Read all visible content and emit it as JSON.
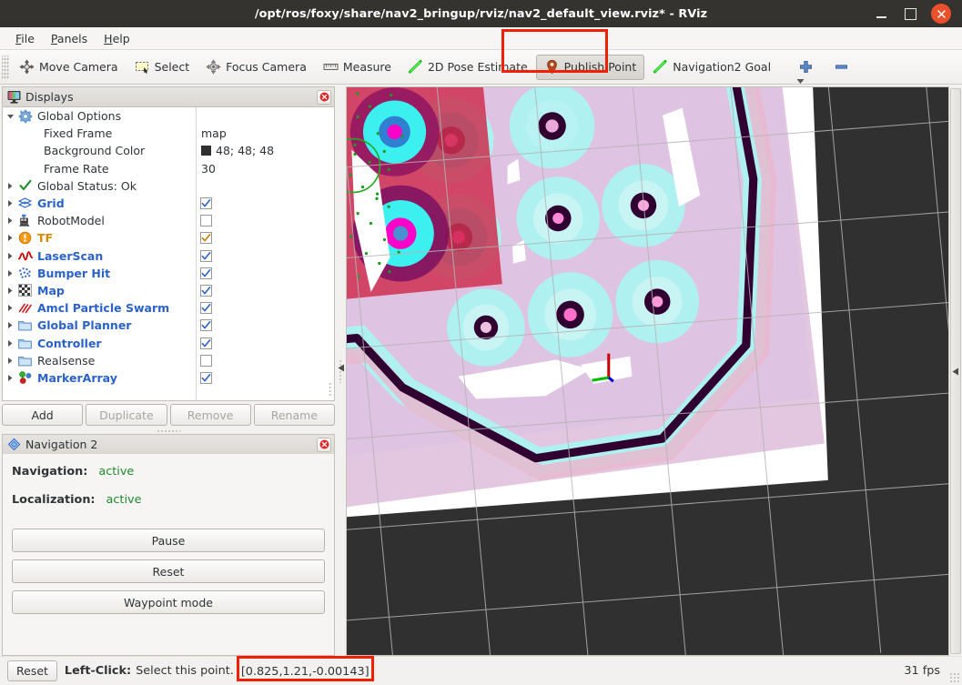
{
  "window": {
    "title": "/opt/ros/foxy/share/nav2_bringup/rviz/nav2_default_view.rviz* - RViz",
    "minimize_label": "minimize-window",
    "maximize_label": "maximize-window",
    "close_label": "close-window"
  },
  "menubar": {
    "items": [
      {
        "label": "File"
      },
      {
        "label": "Panels"
      },
      {
        "label": "Help"
      }
    ]
  },
  "toolbar": {
    "items": [
      {
        "label": "Move Camera",
        "icon": "move-camera-icon",
        "checked": false
      },
      {
        "label": "Select",
        "icon": "select-icon",
        "checked": false
      },
      {
        "label": "Focus Camera",
        "icon": "focus-camera-icon",
        "checked": false
      },
      {
        "label": "Measure",
        "icon": "measure-icon",
        "checked": false
      },
      {
        "label": "2D Pose Estimate",
        "icon": "pose-estimate-icon",
        "checked": false
      },
      {
        "label": "Publish Point",
        "icon": "publish-point-icon",
        "checked": true
      },
      {
        "label": "Navigation2 Goal",
        "icon": "navigation-goal-icon",
        "checked": false
      }
    ],
    "add_tool_icon": "plus-icon",
    "remove_tool_icon": "minus-icon",
    "overflow_icon": "chevron-down-icon",
    "highlight_color": "#f02000"
  },
  "displays_panel": {
    "title": "Displays",
    "icon": "display-monitor-icon",
    "close_icon": "close-icon",
    "rows": [
      {
        "label": "Global Options",
        "icon": "gear-icon",
        "arrow": "down",
        "style": "plain",
        "control": "none"
      },
      {
        "label": "Fixed Frame",
        "icon": "none",
        "arrow": "none",
        "style": "plain",
        "control": "text",
        "value": "map",
        "indent": 2
      },
      {
        "label": "Background Color",
        "icon": "none",
        "arrow": "none",
        "style": "plain",
        "control": "color",
        "value": "48; 48; 48",
        "swatch": "#303030",
        "indent": 2
      },
      {
        "label": "Frame Rate",
        "icon": "none",
        "arrow": "none",
        "style": "plain",
        "control": "text",
        "value": "30",
        "indent": 2
      },
      {
        "label": "Global Status: Ok",
        "icon": "check-icon",
        "arrow": "right",
        "style": "plain",
        "control": "none"
      },
      {
        "label": "Grid",
        "icon": "grid-icon",
        "arrow": "right",
        "style": "blue",
        "control": "checkbox",
        "checked": true
      },
      {
        "label": "RobotModel",
        "icon": "robot-icon",
        "arrow": "right",
        "style": "plain",
        "control": "checkbox",
        "checked": false
      },
      {
        "label": "TF",
        "icon": "tf-icon",
        "arrow": "right",
        "style": "orange",
        "control": "checkbox",
        "checked": true,
        "check_color": "#c08000"
      },
      {
        "label": "LaserScan",
        "icon": "laserscan-icon",
        "arrow": "right",
        "style": "blue",
        "control": "checkbox",
        "checked": true
      },
      {
        "label": "Bumper Hit",
        "icon": "pointcloud-icon",
        "arrow": "right",
        "style": "blue",
        "control": "checkbox",
        "checked": true
      },
      {
        "label": "Map",
        "icon": "map-icon",
        "arrow": "right",
        "style": "blue",
        "control": "checkbox",
        "checked": true
      },
      {
        "label": "Amcl Particle Swarm",
        "icon": "posearray-icon",
        "arrow": "right",
        "style": "blue",
        "control": "checkbox",
        "checked": true
      },
      {
        "label": "Global Planner",
        "icon": "folder-icon",
        "arrow": "right",
        "style": "blue",
        "control": "checkbox",
        "checked": true
      },
      {
        "label": "Controller",
        "icon": "folder-icon",
        "arrow": "right",
        "style": "blue",
        "control": "checkbox",
        "checked": true
      },
      {
        "label": "Realsense",
        "icon": "folder-icon",
        "arrow": "right",
        "style": "plain",
        "control": "checkbox",
        "checked": false
      },
      {
        "label": "MarkerArray",
        "icon": "markerarray-icon",
        "arrow": "right",
        "style": "blue",
        "control": "checkbox",
        "checked": true
      }
    ],
    "buttons": [
      {
        "label": "Add",
        "enabled": true
      },
      {
        "label": "Duplicate",
        "enabled": false
      },
      {
        "label": "Remove",
        "enabled": false
      },
      {
        "label": "Rename",
        "enabled": false
      }
    ]
  },
  "nav_panel": {
    "title": "Navigation 2",
    "icon": "nav2-diamond-icon",
    "close_icon": "close-icon",
    "status": [
      {
        "key": "Navigation:",
        "value": "active"
      },
      {
        "key": "Localization:",
        "value": "active"
      }
    ],
    "buttons": [
      {
        "label": "Pause"
      },
      {
        "label": "Reset"
      },
      {
        "label": "Waypoint mode"
      }
    ],
    "status_color": "#1f8a2a"
  },
  "statusbar": {
    "reset_label": "Reset",
    "hint_prefix": "Left-Click:",
    "hint_text": "Select this point.",
    "coordinate": "[0.825,1.21,-0.00143]",
    "fps": "31 fps",
    "highlight_color": "#f02000"
  },
  "render_view": {
    "background_color": "#303030",
    "grid_color": "#b4b4b4",
    "map_free_color": "#ffffff",
    "costmap_colors": [
      "#00e5e5",
      "#aff0f0",
      "#dfc0e0",
      "#e8b9cf",
      "#ff2060",
      "#ff00c8",
      "#2f0030"
    ],
    "axes_colors": {
      "x": "#cc0000",
      "y": "#00bb00",
      "z": "#0000dd"
    },
    "particle_color": "#22aa22"
  }
}
